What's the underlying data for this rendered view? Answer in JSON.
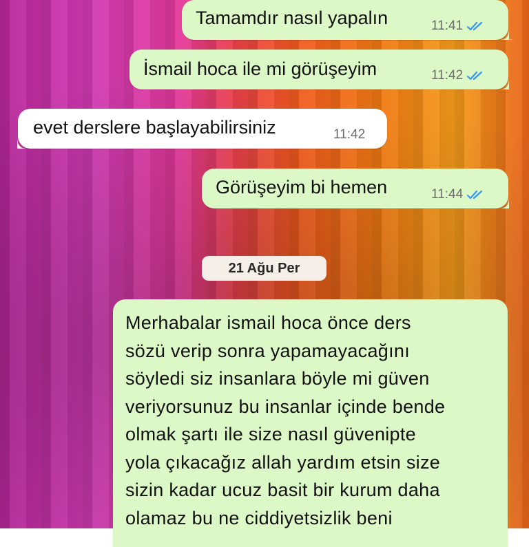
{
  "chat": {
    "messages": [
      {
        "direction": "out",
        "text": "Tamamdır nasıl yapalın",
        "time": "11:41",
        "status": "read"
      },
      {
        "direction": "out",
        "text": "İsmail hoca ile mi görüşeyim",
        "time": "11:42",
        "status": "read"
      },
      {
        "direction": "in",
        "text": "evet derslere başlayabilirsiniz",
        "time": "11:42"
      },
      {
        "direction": "out",
        "text": "Görüşeyim bi hemen",
        "time": "11:44",
        "status": "read"
      }
    ],
    "date_divider": "21 Ağu Per",
    "long_message": {
      "direction": "out",
      "lines": [
        "Merhabalar ismail hoca önce ders",
        "sözü verip sonra yapamayacağını",
        "söyledi siz insanlara böyle mi güven",
        "veriyorsunuz bu insanlar içinde bende",
        "olmak şartı ile size nasıl güvenipte",
        "yola çıkacağız allah yardım etsin size",
        "sizin kadar ucuz basit bir kurum daha",
        "olamaz bu ne ciddiyetsizlik beni"
      ]
    }
  },
  "colors": {
    "outgoing_bubble": "#dcf8c6",
    "incoming_bubble": "#ffffff",
    "read_ticks": "#3497f9"
  },
  "icons": {
    "read_receipt": "double-check-icon"
  }
}
